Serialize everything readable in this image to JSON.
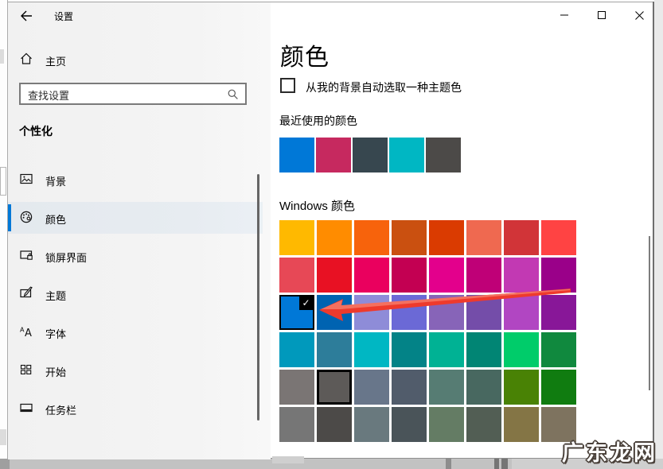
{
  "window": {
    "title": "设置",
    "controls": {
      "minimize": "minimize",
      "maximize": "maximize",
      "close": "close"
    }
  },
  "sidebar": {
    "home_label": "主页",
    "search_placeholder": "查找设置",
    "section_label": "个性化",
    "items": [
      {
        "label": "背景",
        "icon": "image-icon",
        "selected": false
      },
      {
        "label": "颜色",
        "icon": "palette-icon",
        "selected": true
      },
      {
        "label": "锁屏界面",
        "icon": "lockscreen-icon",
        "selected": false
      },
      {
        "label": "主题",
        "icon": "theme-brush-icon",
        "selected": false
      },
      {
        "label": "字体",
        "icon": "fonts-icon",
        "selected": false
      },
      {
        "label": "开始",
        "icon": "start-layout-icon",
        "selected": false
      },
      {
        "label": "任务栏",
        "icon": "taskbar-icon",
        "selected": false
      }
    ]
  },
  "content": {
    "heading": "颜色",
    "auto_accent_checkbox": {
      "label": "从我的背景自动选取一种主题色",
      "checked": false
    },
    "recent_colors": {
      "label": "最近使用的颜色",
      "values": [
        "#0078D7",
        "#C6295F",
        "#37474F",
        "#00B7C3",
        "#4C4A48"
      ]
    },
    "windows_colors": {
      "label": "Windows 颜色",
      "rows": [
        [
          "#FFB900",
          "#FF8C00",
          "#F7630C",
          "#CA5010",
          "#DA3B01",
          "#EF6950",
          "#D13438",
          "#FF4343"
        ],
        [
          "#E74856",
          "#E81123",
          "#EA005E",
          "#C30052",
          "#E3008C",
          "#BF0077",
          "#C239B3",
          "#9A0089"
        ],
        [
          "#0078D7",
          "#0063B1",
          "#8E8CD8",
          "#6B69D6",
          "#8764B8",
          "#744DA9",
          "#B146C2",
          "#881798"
        ],
        [
          "#0099BC",
          "#2D7D9A",
          "#00B7C3",
          "#038387",
          "#00B294",
          "#018574",
          "#00CC6A",
          "#10893E"
        ],
        [
          "#7A7574",
          "#5D5A58",
          "#68768A",
          "#515C6B",
          "#567C73",
          "#486860",
          "#498205",
          "#107C10"
        ],
        [
          "#767676",
          "#4C4A48",
          "#69797E",
          "#4A5459",
          "#647C64",
          "#525E54",
          "#847545",
          "#7E735F"
        ]
      ],
      "selected": {
        "row": 2,
        "col": 0,
        "color": "#0078D7",
        "check_glyph": "✓"
      },
      "outlined": {
        "row": 4,
        "col": 1
      }
    }
  },
  "annotation": {
    "arrow_color": "#EE3A2C",
    "arrow_highlight": "#F4705F"
  },
  "watermark": {
    "text": "广东龙网"
  },
  "colors": {
    "accent": "#0078D7",
    "sidebar_bg": "#F2F2F2",
    "selection_bar": "#0078D7"
  }
}
